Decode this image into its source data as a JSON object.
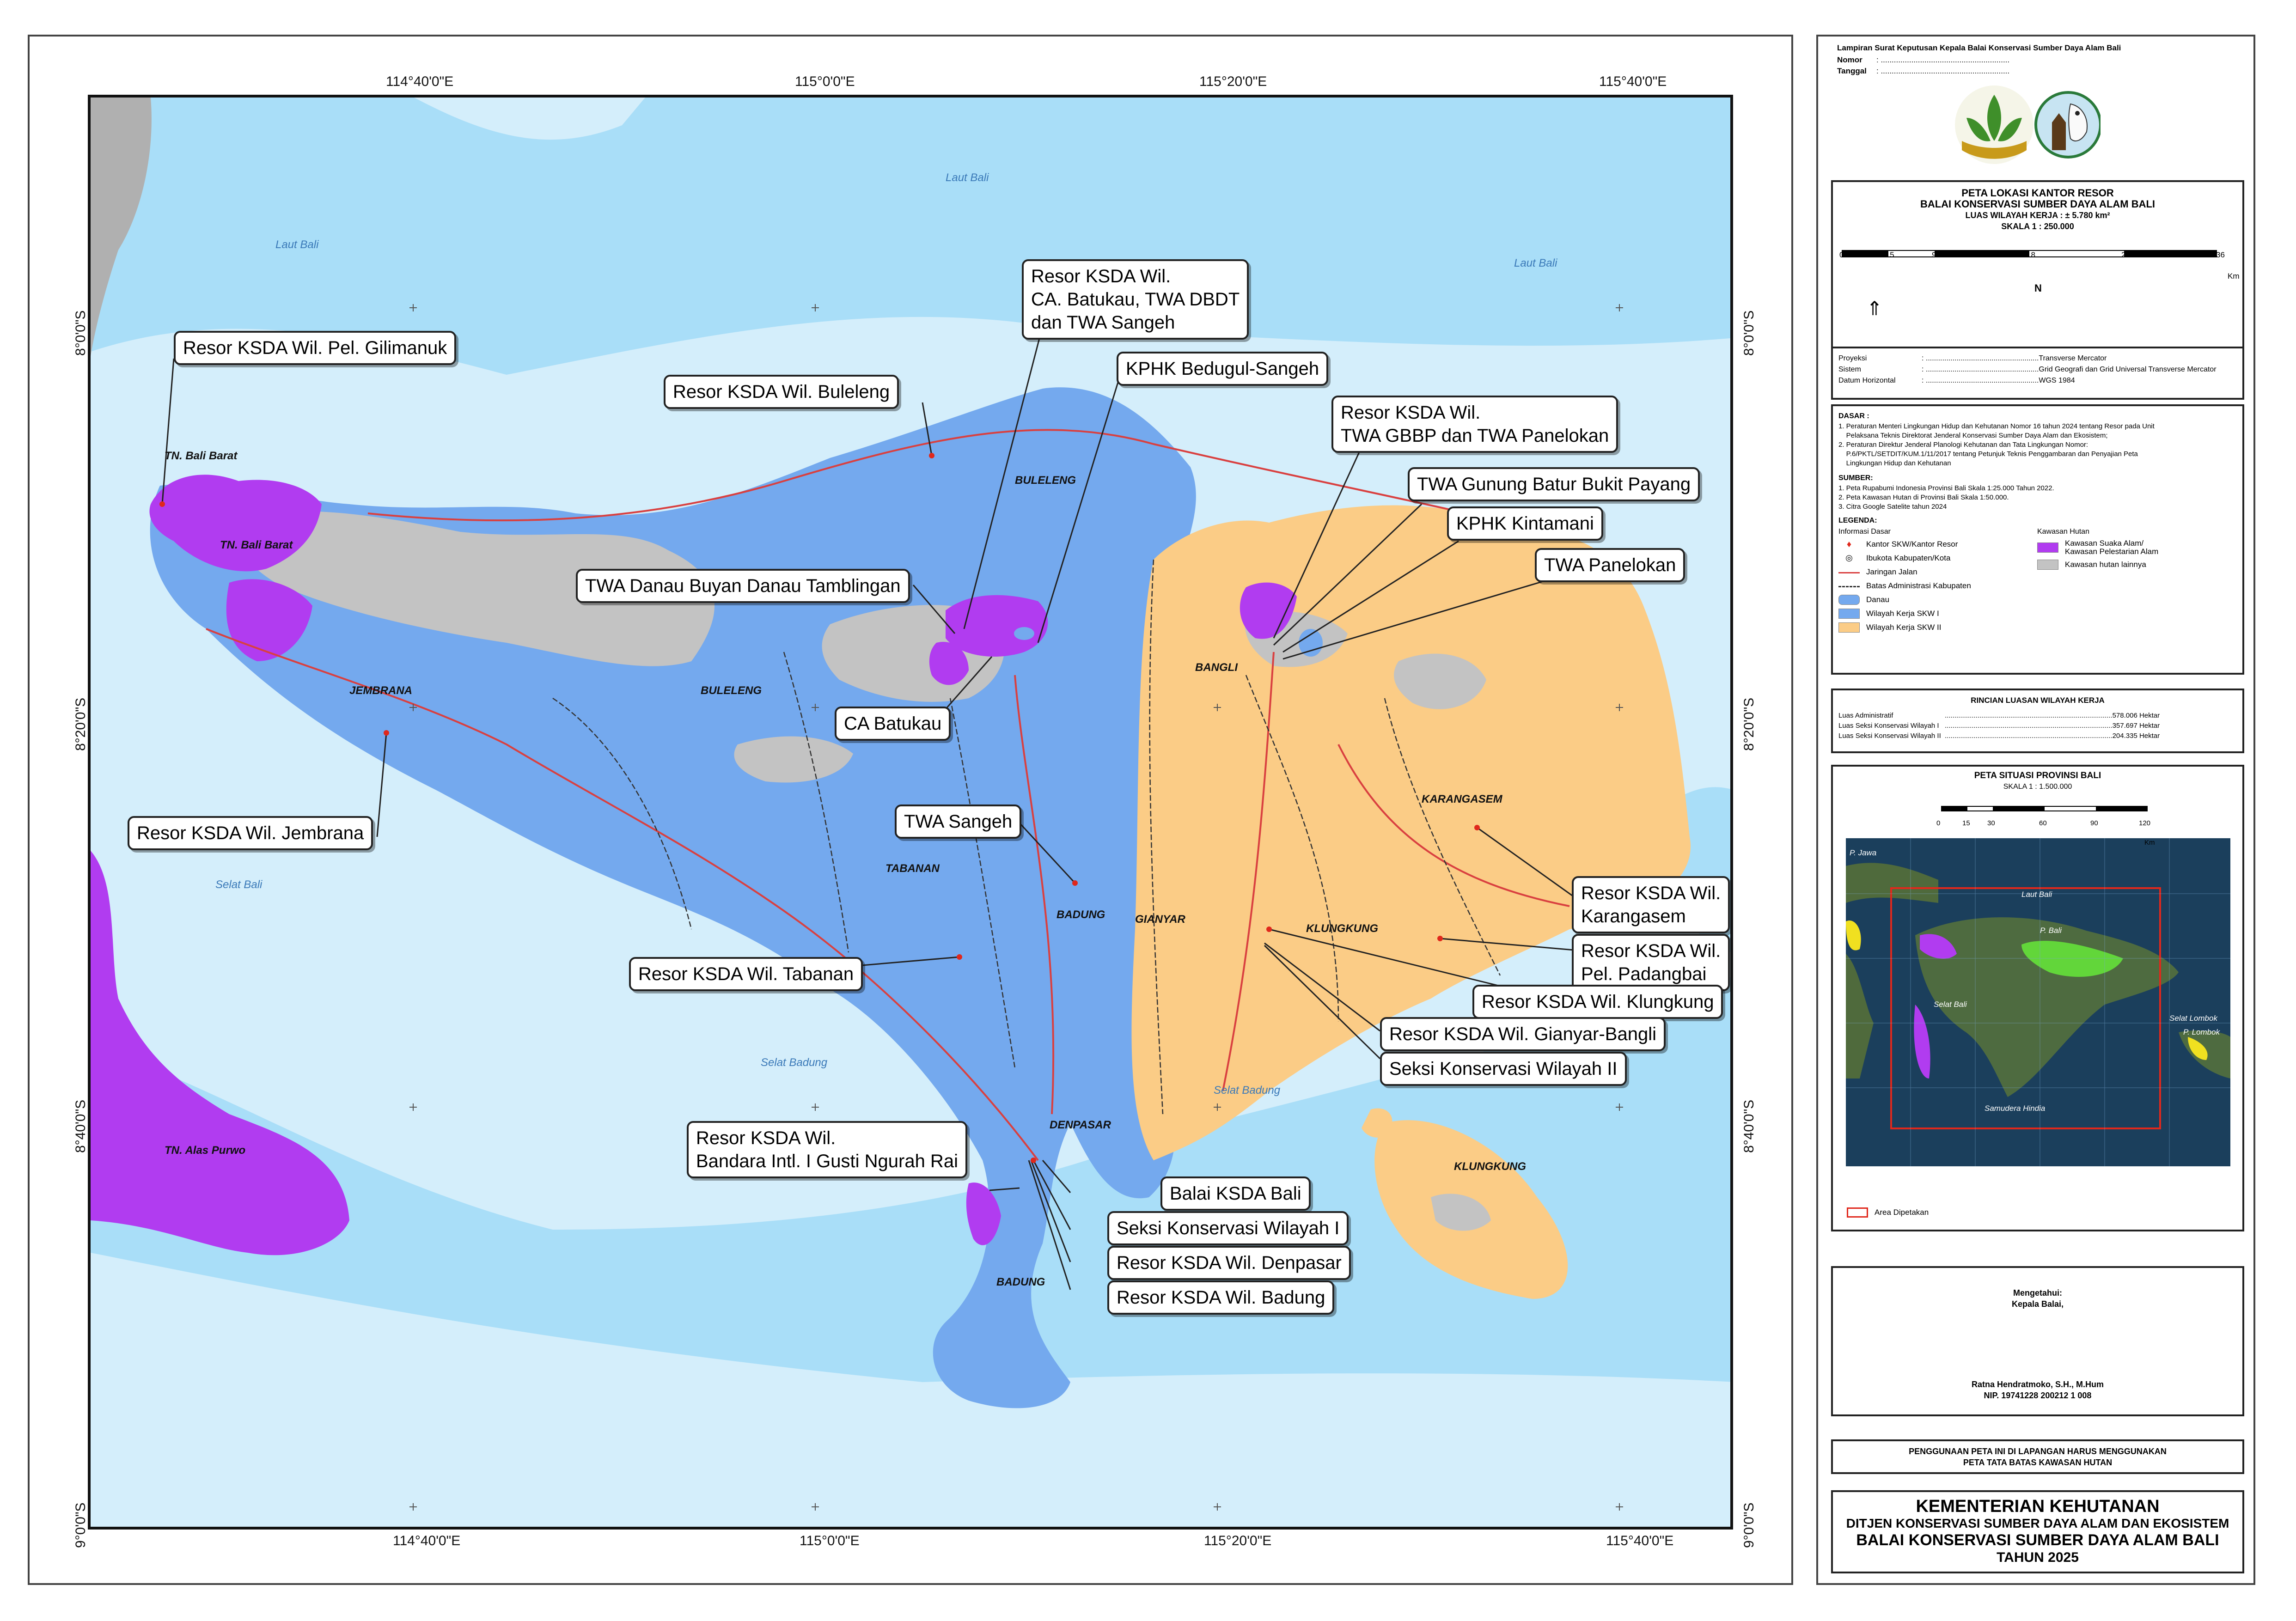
{
  "grid": {
    "lon_top": [
      "114°40'0\"E",
      "115°0'0\"E",
      "115°20'0\"E",
      "115°40'0\"E"
    ],
    "lon_bottom": [
      "114°40'0\"E",
      "115°0'0\"E",
      "115°20'0\"E",
      "115°40'0\"E"
    ],
    "lat_left": [
      "8°0'0\"S",
      "8°20'0\"S",
      "8°40'0\"S",
      "9°0'0\"S"
    ],
    "lat_right": [
      "8°0'0\"S",
      "8°20'0\"S",
      "8°40'0\"S",
      "9°0'0\"S"
    ]
  },
  "sea_labels": {
    "laut_bali_1": "Laut Bali",
    "laut_bali_2": "Laut Bali",
    "laut_bali_3": "Laut Bali",
    "selat_bali": "Selat Bali",
    "selat_badung_1": "Selat Badung",
    "selat_badung_2": "Selat Badung"
  },
  "map_labels": {
    "tn_bali_barat_1": "TN. Bali Barat",
    "tn_bali_barat_2": "TN. Bali Barat",
    "tn_alas_purwo": "TN. Alas Purwo",
    "jembrana": "JEMBRANA",
    "buleleng_1": "BULELENG",
    "buleleng_2": "BULELENG",
    "tabanan": "TABANAN",
    "badung_1": "BADUNG",
    "badung_2": "BADUNG",
    "gianyar": "GIANYAR",
    "bangli": "BANGLI",
    "karangasem": "KARANGASEM",
    "klungkung_1": "KLUNGKUNG",
    "klungkung_2": "KLUNGKUNG",
    "denpasar": "DENPASAR"
  },
  "callouts": {
    "gilimanuk": "Resor KSDA Wil. Pel. Gilimanuk",
    "batukau_group": "Resor KSDA Wil.\nCA. Batukau, TWA DBDT\ndan TWA Sangeh",
    "buleleng": "Resor KSDA Wil. Buleleng",
    "kphk_bedugul": "KPHK Bedugul-Sangeh",
    "gbbp": "Resor KSDA Wil.\nTWA GBBP dan TWA Panelokan",
    "twa_batur": "TWA Gunung Batur Bukit Payang",
    "kphk_kintamani": "KPHK Kintamani",
    "twa_panelokan": "TWA Panelokan",
    "twa_buyan": "TWA Danau Buyan Danau Tamblingan",
    "ca_batukau": "CA Batukau",
    "jembrana": "Resor KSDA Wil. Jembrana",
    "twa_sangeh": "TWA Sangeh",
    "karangasem": "Resor KSDA Wil.\nKarangasem",
    "padangbai": "Resor KSDA Wil.\nPel. Padangbai",
    "klungkung": "Resor KSDA Wil. Klungkung",
    "tabanan": "Resor KSDA Wil. Tabanan",
    "gianyar_bangli": "Resor KSDA Wil. Gianyar-Bangli",
    "seksi2": "Seksi Konservasi Wilayah II",
    "bandara": "Resor KSDA Wil.\nBandara Intl. I Gusti Ngurah Rai",
    "balai": "Balai KSDA Bali",
    "seksi1": "Seksi Konservasi Wilayah I",
    "denpasar": "Resor KSDA Wil. Denpasar",
    "badung": "Resor KSDA Wil. Badung"
  },
  "header": {
    "lampiran": "Lampiran Surat Keputusan Kepala Balai Konservasi Sumber Daya Alam Bali",
    "nomor_label": "Nomor",
    "nomor_value": ": ...........................................................",
    "tanggal_label": "Tanggal",
    "tanggal_value": ": ..........................................................."
  },
  "title": {
    "line1": "PETA LOKASI KANTOR RESOR",
    "line2": "BALAI KONSERVASI SUMBER DAYA ALAM BALI",
    "luas": "LUAS WILAYAH KERJA  :  ±   5.780 km²",
    "skala": "SKALA   1 : 250.000",
    "scale_ticks": [
      "0",
      "4.5",
      "9",
      "18",
      "27",
      "36"
    ],
    "scale_unit": "Km",
    "north": "N"
  },
  "projection": [
    {
      "label": "Proyeksi",
      "value": ": .......................................................Transverse Mercator"
    },
    {
      "label": "Sistem",
      "value": ": .......................................................Grid Geografi dan Grid Universal Transverse Mercator"
    },
    {
      "label": "Datum Horizontal",
      "value": ": .......................................................WGS 1984"
    }
  ],
  "dasar": {
    "title": "DASAR :",
    "items": [
      "1. Peraturan Menteri Lingkungan Hidup dan Kehutanan Nomor 16 tahun 2024 tentang Resor pada Unit",
      "    Pelaksana Teknis Direktorat Jenderal Konservasi Sumber Daya Alam dan Ekosistem;",
      "2. Peraturan Direktur Jenderal Planologi Kehutanan dan Tata Lingkungan Nomor:",
      "    P.6/PKTL/SETDIT/KUM.1/11/2017 tentang Petunjuk Teknis Penggambaran dan Penyajian Peta",
      "    Lingkungan Hidup dan Kehutanan"
    ]
  },
  "sumber": {
    "title": "SUMBER:",
    "items": [
      "1. Peta Rupabumi Indonesia Provinsi Bali Skala 1:25.000 Tahun 2022.",
      "2. Peta Kawasan Hutan di Provinsi Bali Skala 1:50.000.",
      "3. Citra Google Satelite tahun 2024"
    ]
  },
  "legenda": {
    "title": "LEGENDA:",
    "info_title": "Informasi Dasar",
    "info_items": [
      "Kantor SKW/Kantor Resor",
      "Ibukota Kabupaten/Kota",
      "Jaringan Jalan",
      "Batas Administrasi Kabupaten",
      "Danau",
      "Wilayah Kerja SKW I",
      "Wilayah Kerja SKW II"
    ],
    "hutan_title": "Kawasan Hutan",
    "hutan_items": [
      "Kawasan Suaka Alam/ Kawasan Pelestarian Alam",
      "Kawasan hutan lainnya"
    ]
  },
  "rincian": {
    "title": "RINCIAN LUASAN WILAYAH KERJA",
    "rows": [
      {
        "label": "Luas Administratif",
        "value": ".......................................................................................578.006 Hektar"
      },
      {
        "label": "Luas Seksi Konservasi Wilayah I",
        "value": ".......................................................................................357.697 Hektar"
      },
      {
        "label": "Luas Seksi Konservasi Wilayah II",
        "value": ".......................................................................................204.335 Hektar"
      }
    ]
  },
  "situasi": {
    "title": "PETA SITUASI PROVINSI BALI",
    "skala": "SKALA 1 : 1.500.000",
    "ticks": [
      "0",
      "15",
      "30",
      "60",
      "90",
      "120"
    ],
    "unit": "Km",
    "labels": {
      "jawa": "P. Jawa",
      "laut_bali": "Laut Bali",
      "bali": "P. Bali",
      "selat_bali": "Selat Bali",
      "selat_lombok": "Selat Lombok",
      "lombok": "P. Lombok",
      "samudera": "Samudera Hindia"
    },
    "area": "Area Dipetakan"
  },
  "sign": {
    "mengetahui": "Mengetahui:",
    "jabatan": "Kepala Balai,",
    "nama": "Ratna Hendratmoko, S.H., M.Hum",
    "nip": "NIP. 19741228 200212 1 008"
  },
  "warning": {
    "line1": "PENGGUNAAN PETA INI DI LAPANGAN HARUS MENGGUNAKAN",
    "line2": "PETA TATA BATAS KAWASAN HUTAN"
  },
  "footer": {
    "line1": "KEMENTERIAN KEHUTANAN",
    "line2": "DITJEN KONSERVASI SUMBER DAYA ALAM DAN EKOSISTEM",
    "line3": "BALAI KONSERVASI SUMBER DAYA ALAM BALI",
    "line4": "TAHUN 2025"
  },
  "colors": {
    "sea": "#a9def8",
    "shallow": "#d4eefb",
    "skw1": "#74a9ee",
    "skw2": "#fbcc86",
    "forest_other": "#c3c3c3",
    "conservation": "#b13cf0",
    "road": "#d94040",
    "java": "#b0b0b0"
  }
}
